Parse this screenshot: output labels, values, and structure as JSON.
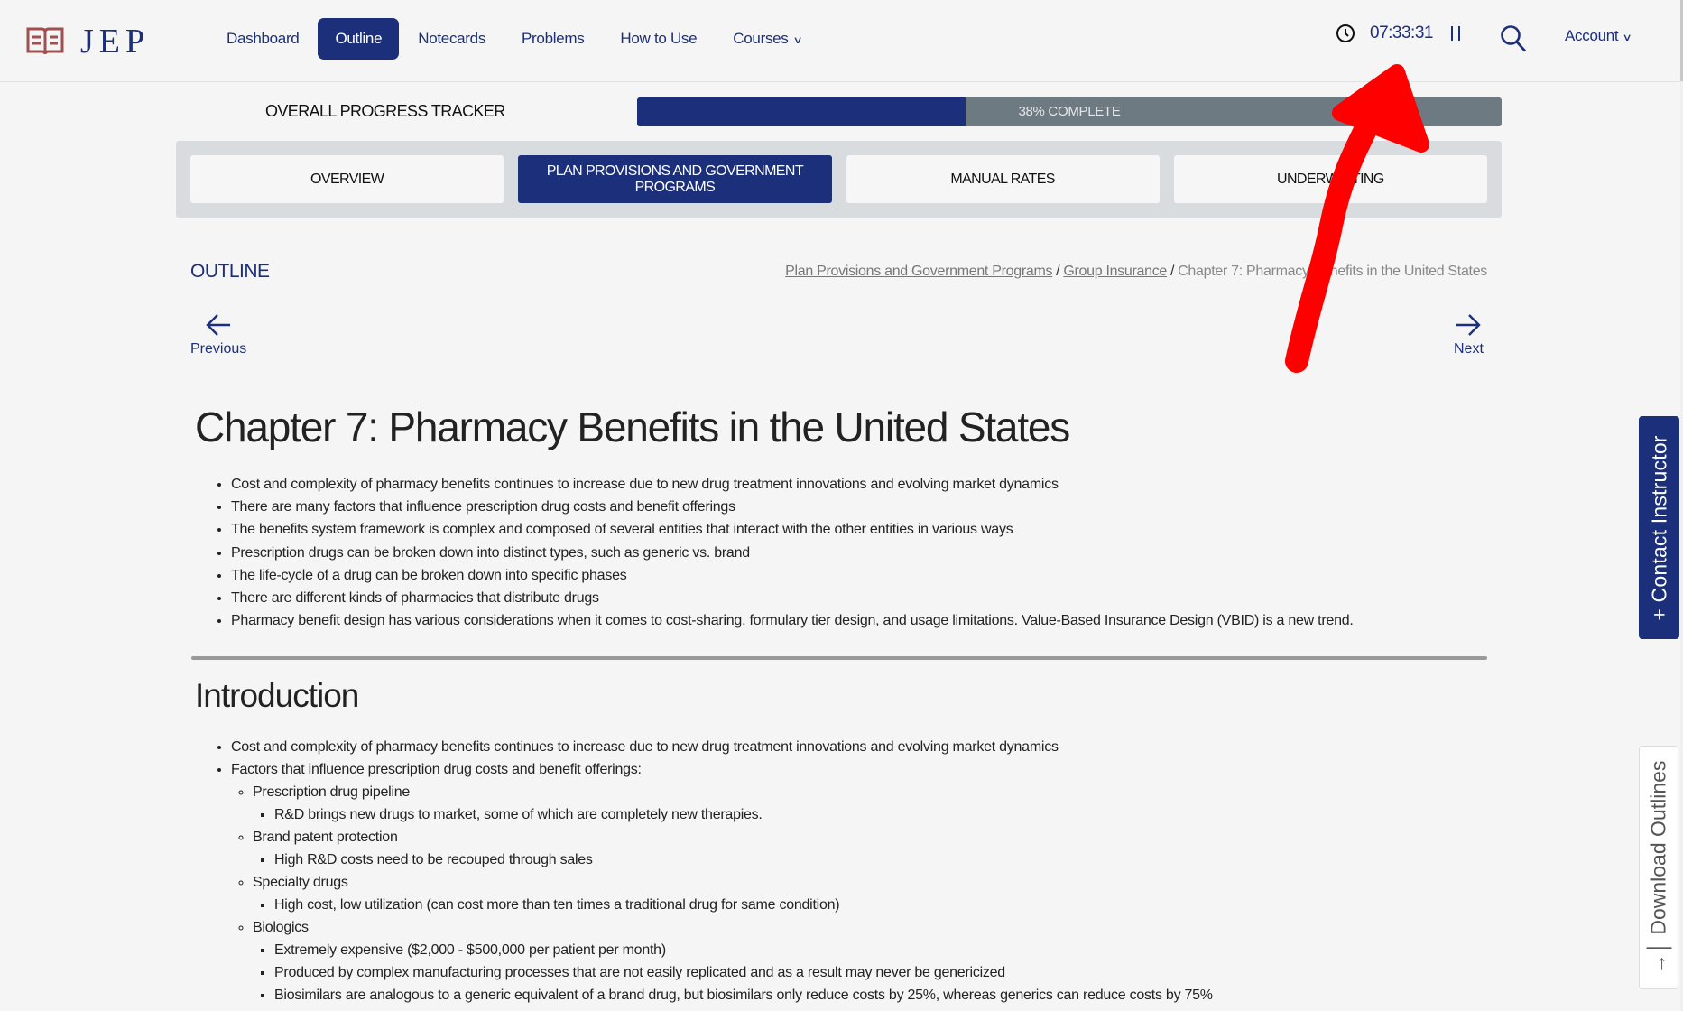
{
  "brand": {
    "name": "JEP",
    "icon": "open-book-icon"
  },
  "nav": {
    "items": [
      {
        "label": "Dashboard",
        "active": false
      },
      {
        "label": "Outline",
        "active": true
      },
      {
        "label": "Notecards",
        "active": false
      },
      {
        "label": "Problems",
        "active": false
      },
      {
        "label": "How to Use",
        "active": false
      },
      {
        "label": "Courses",
        "active": false,
        "dropdown": true
      }
    ],
    "timer": "07:33:31",
    "timer_icon": "clock-icon",
    "pause_icon": "pause-icon",
    "search_icon": "search-icon",
    "account_label": "Account"
  },
  "progress": {
    "label": "OVERALL PROGRESS TRACKER",
    "percent": 38,
    "text": "38% COMPLETE"
  },
  "course_tabs": [
    {
      "label": "OVERVIEW",
      "active": false
    },
    {
      "label": "PLAN PROVISIONS AND GOVERNMENT PROGRAMS",
      "active": true
    },
    {
      "label": "MANUAL RATES",
      "active": false
    },
    {
      "label": "UNDERWRITING",
      "active": false
    }
  ],
  "outline": {
    "title": "OUTLINE",
    "breadcrumb": [
      {
        "label": "Plan Provisions and Government Programs",
        "link": true
      },
      {
        "label": "Group Insurance",
        "link": true
      },
      {
        "label": "Chapter 7: Pharmacy Benefits in the United States",
        "link": false
      }
    ],
    "separator": "/",
    "prev_label": "Previous",
    "next_label": "Next"
  },
  "content": {
    "chapter_title": "Chapter 7: Pharmacy Benefits in the United States",
    "summary": [
      "Cost and complexity of pharmacy benefits continues to increase due to new drug treatment innovations and evolving market dynamics",
      "There are many factors that influence prescription drug costs and benefit offerings",
      "The benefits system framework is complex and composed of several entities that interact with the other entities in various ways",
      "Prescription drugs can be broken down into distinct types, such as generic vs. brand",
      "The life-cycle of a drug can be broken down into specific phases",
      "There are different kinds of pharmacies that distribute drugs",
      "Pharmacy benefit design has various considerations when it comes to cost-sharing, formulary tier design, and usage limitations. Value-Based Insurance Design (VBID) is a new trend."
    ],
    "section_title": "Introduction",
    "intro": {
      "item1": "Cost and complexity of pharmacy benefits continues to increase due to new drug treatment innovations and evolving market dynamics",
      "item2": "Factors that influence prescription drug costs and benefit offerings:",
      "factors": [
        {
          "label": "Prescription drug pipeline",
          "details": [
            "R&D brings new drugs to market, some of which are completely new therapies."
          ]
        },
        {
          "label": "Brand patent protection",
          "details": [
            "High R&D costs need to be recouped through sales"
          ]
        },
        {
          "label": "Specialty drugs",
          "details": [
            "High cost, low utilization (can cost more than ten times a traditional drug for same condition)"
          ]
        },
        {
          "label": "Biologics",
          "details": [
            "Extremely expensive ($2,000 - $500,000 per patient per month)",
            "Produced by complex manufacturing processes that are not easily replicated and as a result may never be genericized",
            "Biosimilars are analogous to a generic equivalent of a brand drug, but biosimilars only reduce costs by 25%, whereas generics can reduce costs by 75%"
          ]
        }
      ]
    }
  },
  "side_tabs": {
    "contact": "+ Contact Instructor",
    "download": "→│ Download Outlines"
  },
  "colors": {
    "brand": "#1c2f7a",
    "logo_icon": "#a05050",
    "progress_track": "#6e7a82",
    "annotation": "#ff0000"
  }
}
